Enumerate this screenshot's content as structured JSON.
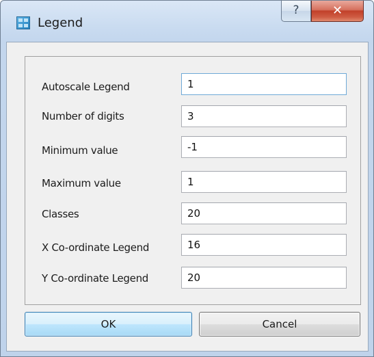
{
  "window": {
    "title": "Legend",
    "app_icon": "legend-app-icon",
    "help_glyph": "?",
    "close_glyph": "✕"
  },
  "form": {
    "fields": [
      {
        "label": "Autoscale Legend",
        "value": "1"
      },
      {
        "label": "Number of digits",
        "value": "3"
      },
      {
        "label": "Minimum value",
        "value": "-1"
      },
      {
        "label": "Maximum value",
        "value": "1"
      },
      {
        "label": "Classes",
        "value": "20"
      },
      {
        "label": "X Co-ordinate Legend",
        "value": "16"
      },
      {
        "label": "Y Co-ordinate Legend",
        "value": "20"
      }
    ]
  },
  "buttons": {
    "ok_label": "OK",
    "cancel_label": "Cancel"
  },
  "colors": {
    "accent": "#3c7fb1",
    "close_button": "#c1412a",
    "focus_border": "#6ea9d7"
  }
}
